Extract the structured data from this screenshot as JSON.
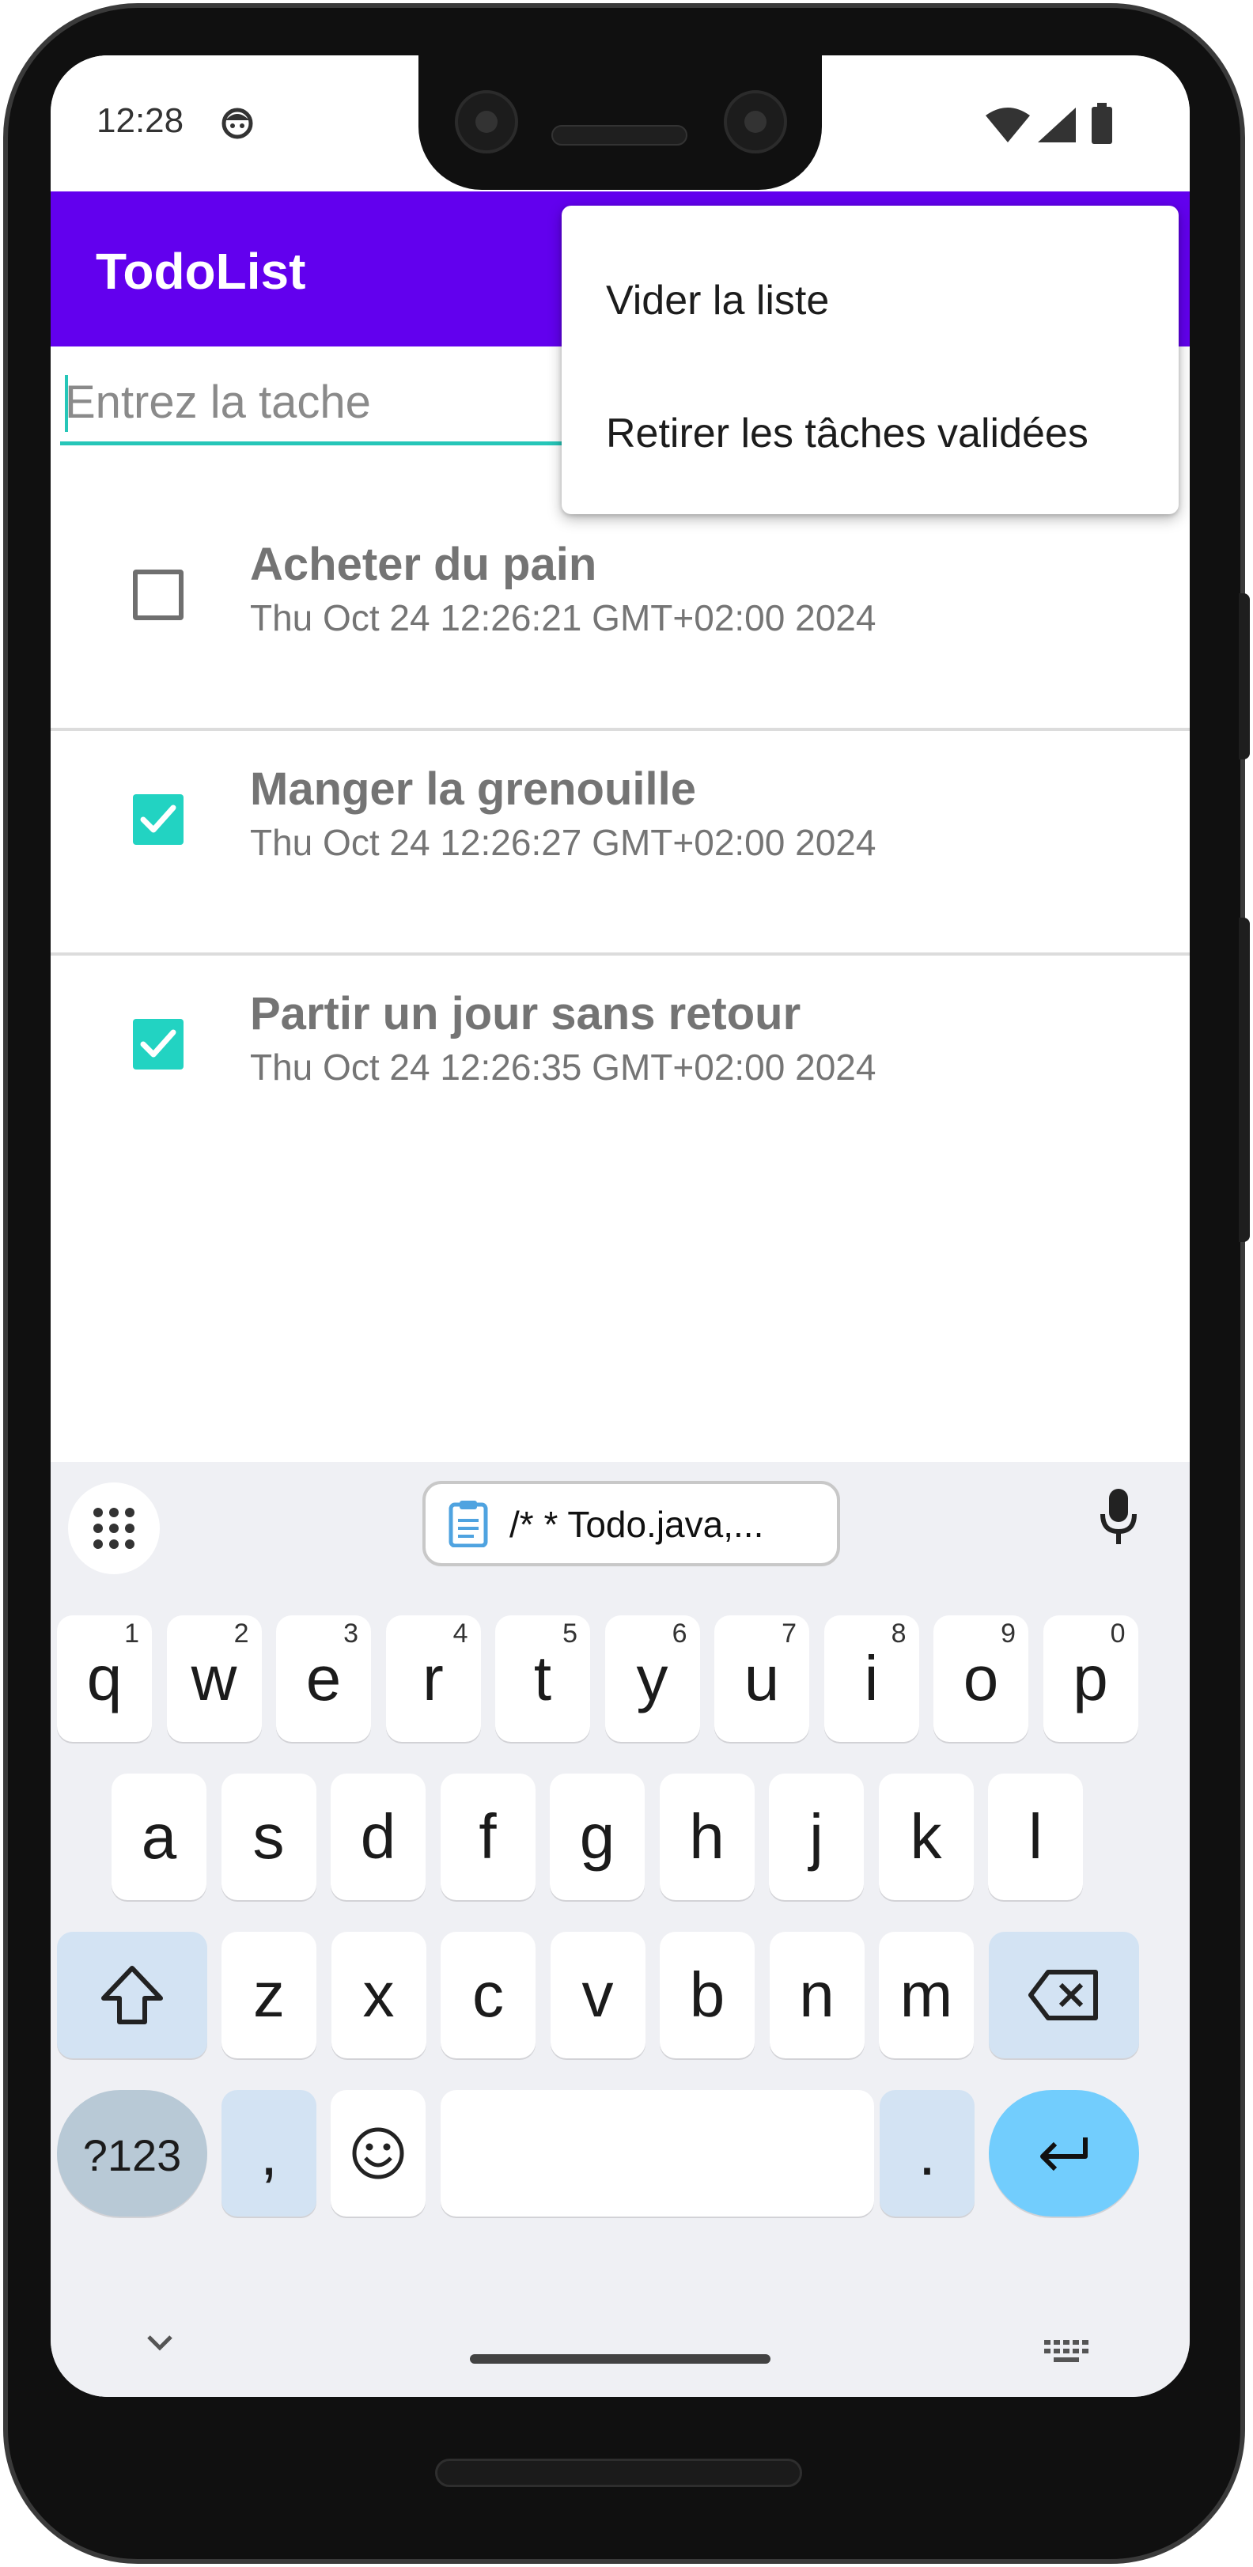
{
  "status_bar": {
    "time": "12:28",
    "icons": [
      "android-face-icon",
      "wifi-icon",
      "signal-icon",
      "battery-icon"
    ]
  },
  "app_bar": {
    "title": "TodoList",
    "color": "#6200ee"
  },
  "input": {
    "placeholder": "Entrez la tache",
    "value": "",
    "accent_color": "#26c6b8"
  },
  "tasks": [
    {
      "title": "Acheter du pain",
      "date": "Thu Oct 24 12:26:21 GMT+02:00 2024",
      "checked": false
    },
    {
      "title": "Manger la grenouille",
      "date": "Thu Oct 24 12:26:27 GMT+02:00 2024",
      "checked": true
    },
    {
      "title": "Partir un jour sans retour",
      "date": "Thu Oct 24 12:26:35 GMT+02:00 2024",
      "checked": true
    }
  ],
  "overflow_menu": {
    "items": [
      "Vider la liste",
      "Retirer les tâches validées"
    ]
  },
  "keyboard": {
    "clipboard_chip": "/*  * Todo.java,...",
    "row1": [
      {
        "key": "q",
        "hint": "1"
      },
      {
        "key": "w",
        "hint": "2"
      },
      {
        "key": "e",
        "hint": "3"
      },
      {
        "key": "r",
        "hint": "4"
      },
      {
        "key": "t",
        "hint": "5"
      },
      {
        "key": "y",
        "hint": "6"
      },
      {
        "key": "u",
        "hint": "7"
      },
      {
        "key": "i",
        "hint": "8"
      },
      {
        "key": "o",
        "hint": "9"
      },
      {
        "key": "p",
        "hint": "0"
      }
    ],
    "row2": [
      "a",
      "s",
      "d",
      "f",
      "g",
      "h",
      "j",
      "k",
      "l"
    ],
    "row3": [
      "z",
      "x",
      "c",
      "v",
      "b",
      "n",
      "m"
    ],
    "symbols_label": "?123",
    "comma": ",",
    "period": ".",
    "enter_color": "#72cdfd"
  }
}
